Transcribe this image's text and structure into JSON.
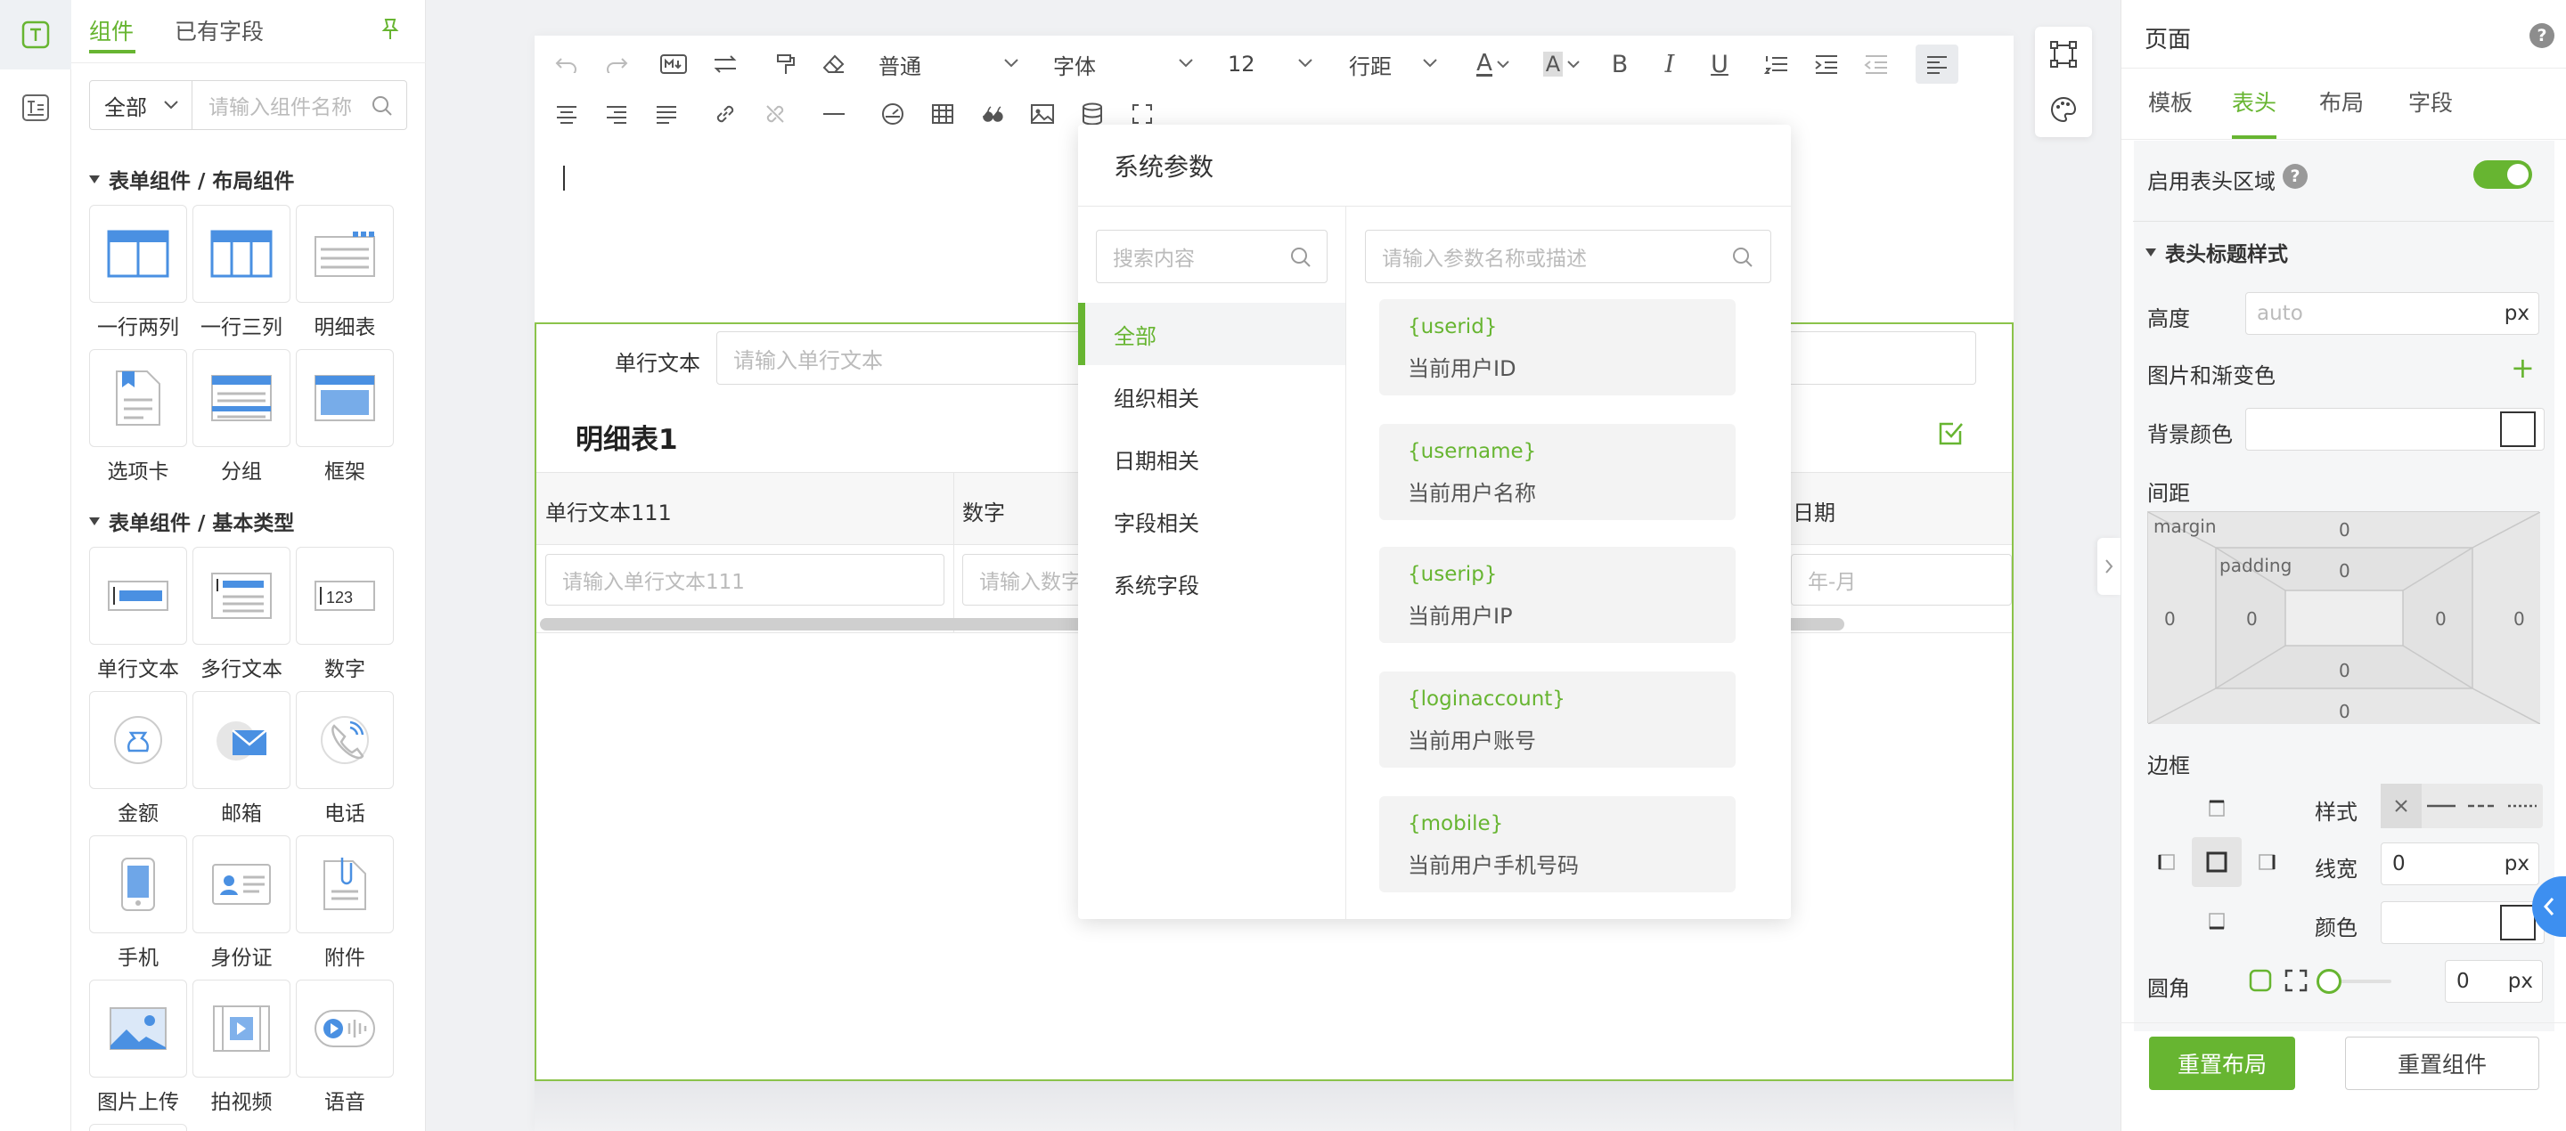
{
  "component_panel": {
    "tabs": [
      "组件",
      "已有字段"
    ],
    "category_select": "全部",
    "search_placeholder": "请输入组件名称",
    "section_layout": "表单组件 / 布局组件",
    "section_basic": "表单组件 / 基本类型",
    "layout_components": [
      "一行两列",
      "一行三列",
      "明细表",
      "选项卡",
      "分组",
      "框架"
    ],
    "basic_components": [
      "单行文本",
      "多行文本",
      "数字",
      "金额",
      "邮箱",
      "电话",
      "手机",
      "身份证",
      "附件",
      "图片上传",
      "拍视频",
      "语音"
    ],
    "number_icon_text": "123"
  },
  "toolbar": {
    "paragraph_select": "普通",
    "font_select": "字体",
    "size_select": "12",
    "line_height_select": "行距",
    "font_color_glyph": "A",
    "bg_color_glyph": "A",
    "bold_glyph": "B",
    "italic_glyph": "I",
    "underline_glyph": "U"
  },
  "form": {
    "single_text_label": "单行文本",
    "single_text_placeholder": "请输入单行文本",
    "detail_title": "明细表1",
    "columns": [
      {
        "header": "单行文本111",
        "placeholder": "请输入单行文本111"
      },
      {
        "header": "数字",
        "placeholder": "请输入数字"
      },
      {
        "header": "日期",
        "placeholder": "年-月"
      }
    ]
  },
  "popup": {
    "title": "系统参数",
    "category_search_placeholder": "搜索内容",
    "param_search_placeholder": "请输入参数名称或描述",
    "categories": [
      "全部",
      "组织相关",
      "日期相关",
      "字段相关",
      "系统字段"
    ],
    "params": [
      {
        "code": "{userid}",
        "desc": "当前用户ID"
      },
      {
        "code": "{username}",
        "desc": "当前用户名称"
      },
      {
        "code": "{userip}",
        "desc": "当前用户IP"
      },
      {
        "code": "{loginaccount}",
        "desc": "当前用户账号"
      },
      {
        "code": "{mobile}",
        "desc": "当前用户手机号码"
      }
    ]
  },
  "props": {
    "title": "页面",
    "help": "?",
    "tabs": [
      "模板",
      "表头",
      "布局",
      "字段"
    ],
    "enable_header": "启用表头区域",
    "header_style_section": "表头标题样式",
    "height_label": "高度",
    "height_placeholder": "auto",
    "unit": "px",
    "image_gradient_label": "图片和渐变色",
    "add_glyph": "+",
    "bg_color_label": "背景颜色",
    "spacing_label": "间距",
    "margin_label": "margin",
    "padding_label": "padding",
    "spacing_values": [
      "0",
      "0",
      "0",
      "0",
      "0",
      "0",
      "0",
      "0"
    ],
    "border_label": "边框",
    "style_label": "样式",
    "line_width_label": "线宽",
    "line_width_value": "0",
    "color_label": "颜色",
    "radius_label": "圆角",
    "radius_value": "0",
    "reset_layout": "重置布局",
    "reset_component": "重置组件"
  },
  "colors": {
    "accent": "#67b531",
    "blue": "#3d8ff0"
  }
}
